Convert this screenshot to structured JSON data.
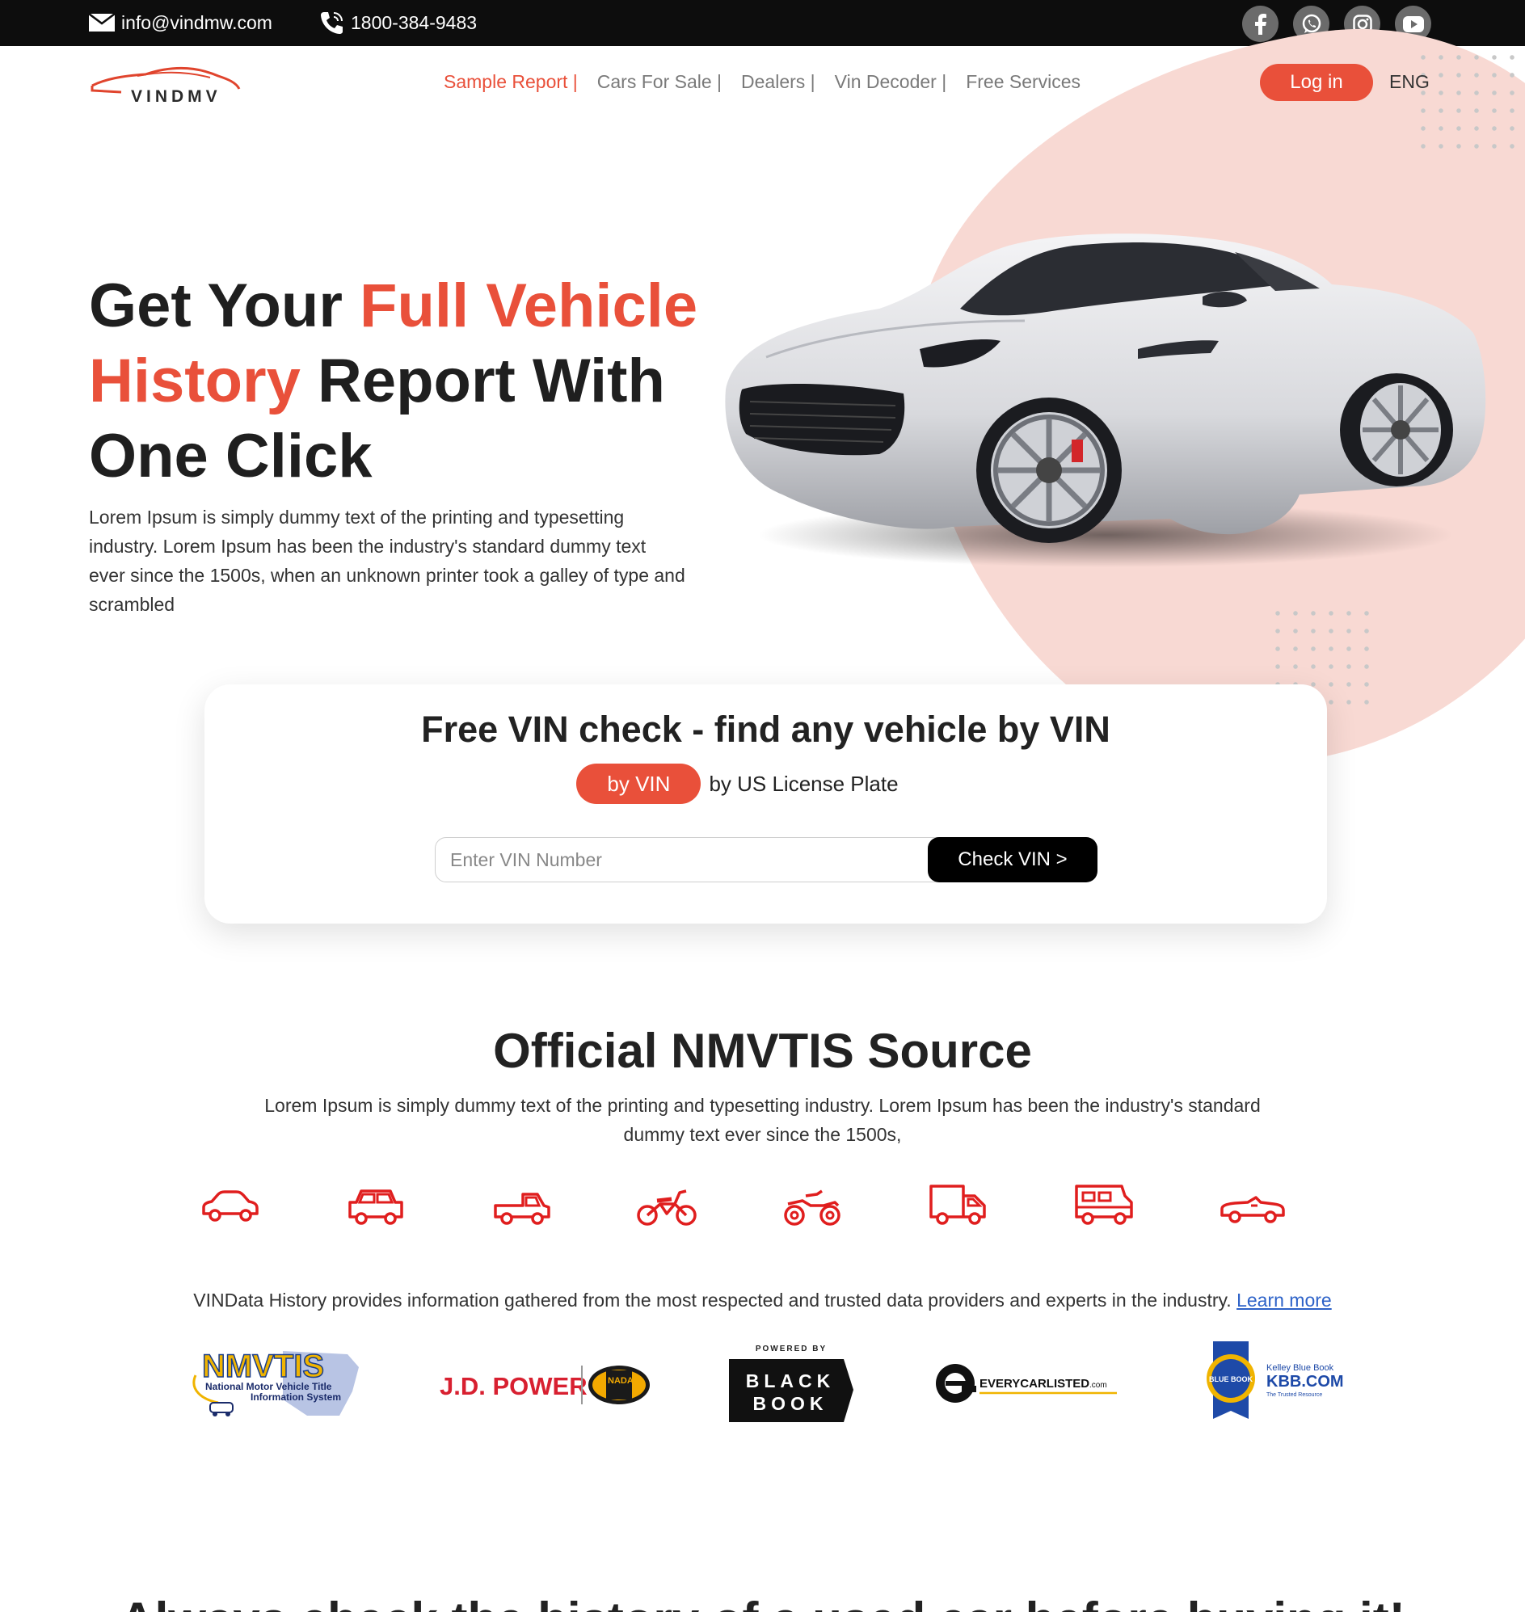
{
  "topbar": {
    "email": "info@vindmw.com",
    "phone": "1800-384-9483",
    "socials": [
      "facebook-icon",
      "whatsapp-icon",
      "instagram-icon",
      "youtube-icon"
    ]
  },
  "logo": {
    "text": "VINDMV"
  },
  "nav": {
    "items": [
      {
        "label": "Sample Report |"
      },
      {
        "label": "Cars For Sale |"
      },
      {
        "label": "Dealers |"
      },
      {
        "label": "Vin Decoder |"
      },
      {
        "label": "Free Services"
      }
    ],
    "login": "Log in",
    "lang": "ENG"
  },
  "hero": {
    "title_1": "Get Your ",
    "title_hl_1": "Full Vehicle",
    "title_hl_2": "History",
    "title_2": " Report With",
    "title_3": "One Click",
    "desc": "Lorem Ipsum is simply dummy text of the printing and typesetting industry. Lorem Ipsum has been the industry's standard dummy text ever since the 1500s, when an unknown printer took a galley of type and scrambled"
  },
  "vin_card": {
    "title": "Free VIN check - find any vehicle by VIN",
    "tab_active": "by VIN",
    "tab_other": "by US License Plate",
    "placeholder": "Enter VIN Number",
    "button": "Check VIN >"
  },
  "nmvtis": {
    "title": "Official NMVTIS Source",
    "desc": "Lorem Ipsum is simply dummy text of the printing and typesetting industry. Lorem Ipsum has been the industry's standard dummy text ever since the 1500s,",
    "vehicle_icons": [
      "sedan-icon",
      "suv-icon",
      "pickup-icon",
      "motorcycle-icon",
      "atv-icon",
      "truck-icon",
      "rv-icon",
      "convertible-icon"
    ],
    "provider_text": "VINData History provides information gathered from the most respected and trusted data providers and experts in the industry. ",
    "learn_more": "Learn more",
    "providers": {
      "nmvtis": {
        "name": "NMVTIS",
        "sub1": "National Motor Vehicle Title",
        "sub2": "Information System"
      },
      "jdpower": {
        "name": "J.D. POWER",
        "badge": "NADA"
      },
      "blackbook": {
        "top": "POWERED BY",
        "line1": "BLACK",
        "line2": "BOOK"
      },
      "everycar": {
        "name": "EVERYCARLISTED",
        "suffix": ".com"
      },
      "kbb": {
        "small": "Kelley Blue Book",
        "name": "KBB.COM",
        "tag": "The Trusted Resource",
        "badge": "BLUE BOOK"
      }
    }
  },
  "bottom": {
    "heading_partial": "Always check the history of a used car before buying it!"
  },
  "colors": {
    "accent": "#e9503a",
    "topbar": "#0d0d0d",
    "blob": "#f8d9d3"
  }
}
